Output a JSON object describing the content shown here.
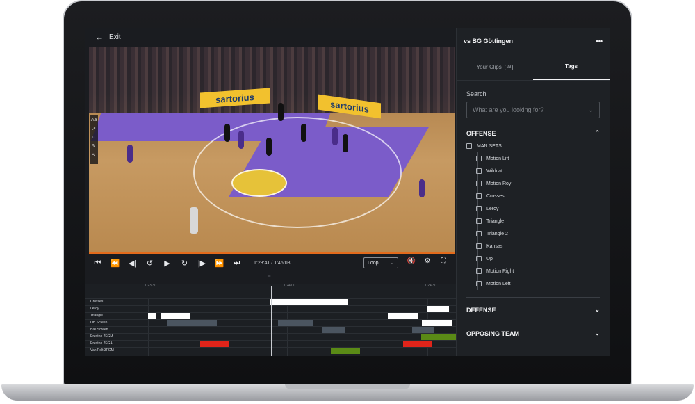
{
  "topbar": {
    "exit_label": "Exit"
  },
  "video": {
    "sponsor_1": "sartorius",
    "sponsor_2": "sartorius",
    "tools": [
      "Aa",
      "↗",
      "○",
      "✎",
      "↖"
    ]
  },
  "controls": {
    "time": "1:23:41 / 1:46:08",
    "loop_label": "Loop",
    "progress_fraction": 1.0
  },
  "timeline": {
    "ticks": [
      "1:23:30",
      "1:24:00",
      "1:24:30"
    ],
    "rows": [
      {
        "label": "Crosses"
      },
      {
        "label": "Leroy"
      },
      {
        "label": "Triangle"
      },
      {
        "label": "OB Screen"
      },
      {
        "label": "Ball Screen"
      },
      {
        "label": "Preston 2FGM"
      },
      {
        "label": "Preston 2FGA"
      },
      {
        "label": "Van Pelt 3FGM"
      }
    ],
    "colors": {
      "white": "#ffffff",
      "gray": "#4b5560",
      "green": "#5a8a16",
      "red": "#e0241a"
    }
  },
  "panel": {
    "title": "vs BG Göttingen",
    "more_icon": "more-horizontal-icon",
    "tabs": [
      {
        "label": "Your Clips",
        "count": "23"
      },
      {
        "label": "Tags"
      }
    ],
    "search_label": "Search",
    "search_placeholder": "What are you looking for?",
    "offense_label": "OFFENSE",
    "man_sets_label": "MAN SETS",
    "man_sets_items": [
      "Motion Lift",
      "Wildcat",
      "Motion Roy",
      "Crosses",
      "Leroy",
      "Triangle",
      "Triangle 2",
      "Kansas",
      "Up",
      "Motion Right",
      "Motion Left"
    ],
    "defense_label": "DEFENSE",
    "opposing_label": "OPPOSING TEAM"
  }
}
